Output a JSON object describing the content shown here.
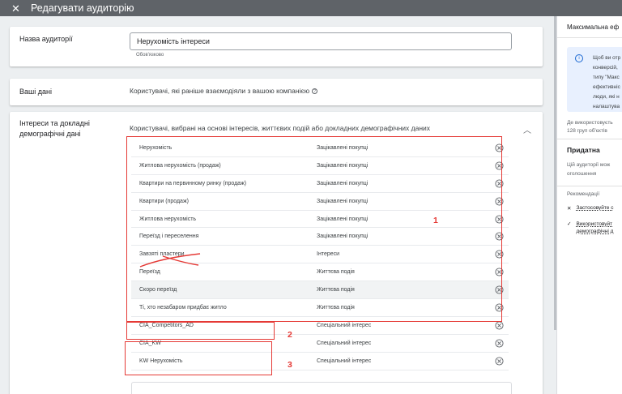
{
  "header": {
    "title": "Редагувати аудиторію"
  },
  "name_section": {
    "label": "Назва аудиторії",
    "value": "Нерухомість інтереси",
    "hint": "Обов'язково"
  },
  "your_data": {
    "label": "Ваші дані",
    "value": "Користувачі, які раніше взаємодіяли з вашою компанією",
    "help": "?"
  },
  "interests": {
    "label": "Інтереси та докладні демографічні дані",
    "desc": "Користувачі, вибрані на основі інтересів, життєвих подій або докладних демографічних даних",
    "rows": [
      {
        "name": "Нерухомість",
        "type": "Зацікавлені покупці"
      },
      {
        "name": "Житлова нерухомість (продаж)",
        "type": "Зацікавлені покупці"
      },
      {
        "name": "Квартири на первинному ринку (продаж)",
        "type": "Зацікавлені покупці"
      },
      {
        "name": "Квартири (продаж)",
        "type": "Зацікавлені покупці"
      },
      {
        "name": "Житлова нерухомість",
        "type": "Зацікавлені покупці"
      },
      {
        "name": "Переїзд і переселення",
        "type": "Зацікавлені покупці"
      },
      {
        "name": "Завзяті пластери",
        "type": "Інтереси"
      },
      {
        "name": "Переїзд",
        "type": "Життєва подія"
      },
      {
        "name": "Скоро переїзд",
        "type": "Життєва подія"
      },
      {
        "name": "Ті, хто незабаром придбає житло",
        "type": "Життєва подія"
      },
      {
        "name": "CIA_Competitors_AD",
        "type": "Спеціальний інтерес"
      },
      {
        "name": "CIA_KW",
        "type": "Спеціальний інтерес"
      },
      {
        "name": "KW Нерухомість",
        "type": "Спеціальний інтерес"
      }
    ]
  },
  "annotations": {
    "a1": "1",
    "a2": "2",
    "a3": "3"
  },
  "side_panel": {
    "title": "Максимальна еф",
    "info_lines": [
      "Щоб ви отр",
      "конверсій,",
      "типу \"Макс",
      "ефективніс",
      "люди, які н",
      "налаштува"
    ],
    "usage_lines": [
      "Де використовуєть",
      "128 груп об'єктів"
    ],
    "suitable_title": "Придатна",
    "suitable_lines": [
      "Цій аудиторії мож",
      "оголошення"
    ],
    "recommendations_label": "Рекомендації",
    "rec1": "Застосовуйте с",
    "rec2_lines": [
      "Використовуйт",
      "демографічні д"
    ]
  },
  "colors": {
    "annotation": "#e53935",
    "topbar": "#5f6368"
  }
}
